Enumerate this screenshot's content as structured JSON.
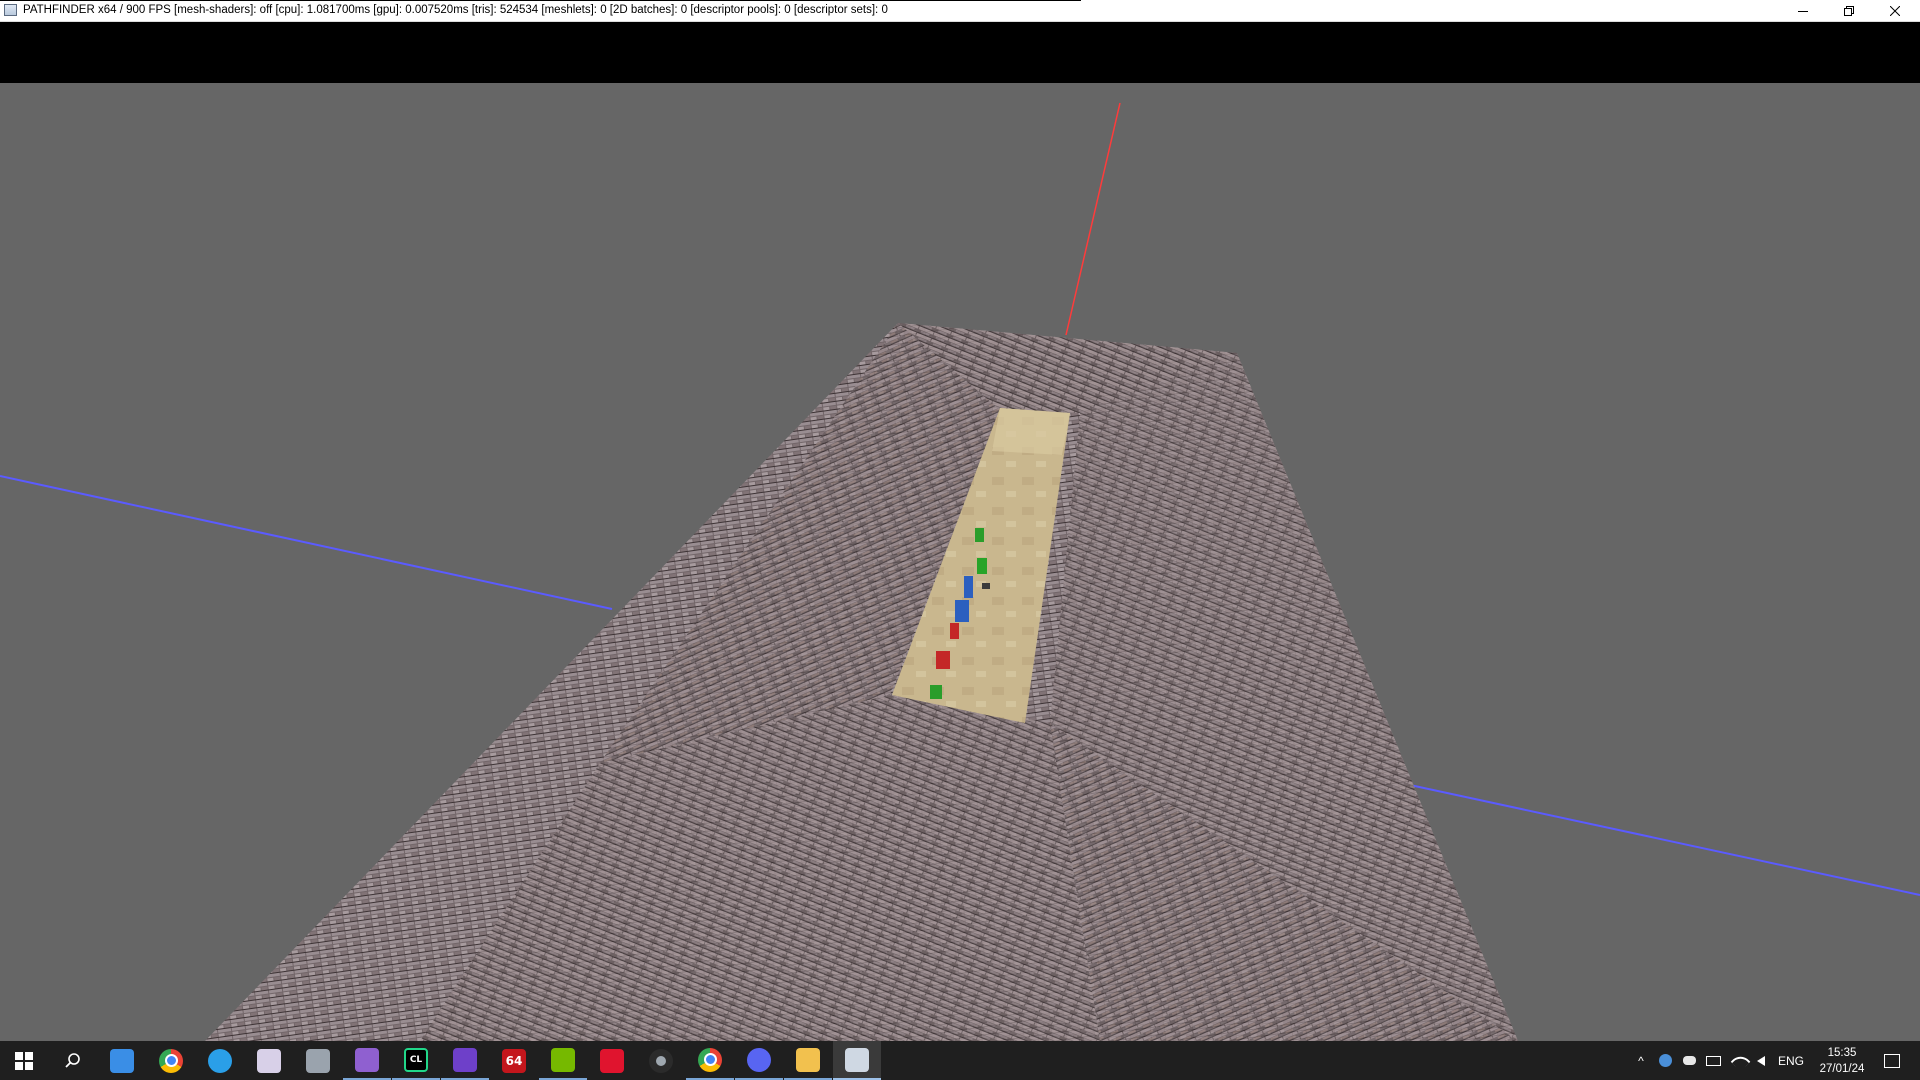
{
  "window": {
    "title": "PATHFINDER x64 / 900 FPS [mesh-shaders]: off [cpu]: 1.081700ms [gpu]: 0.007520ms  [tris]: 524534 [meshlets]: 0 [2D batches]: 0 [descriptor pools]: 0 [descriptor sets]: 0",
    "minimize_glyph": "—",
    "restore_glyph": "❐",
    "close_glyph": "✕"
  },
  "viewport": {
    "background": "#666666",
    "axis_x_color": "#5b5bff",
    "axis_y_color": "#ff3b3b",
    "surface_colors": [
      "#7a6c6e",
      "#9a8c90",
      "#b7aaaf",
      "#5a5052",
      "#a58f86"
    ],
    "trench_color": "#c8b58a"
  },
  "taskbar": {
    "apps": [
      {
        "name": "start-button",
        "icon": "windows-icon",
        "glyph": "",
        "color": "#ffffff"
      },
      {
        "name": "search-button",
        "icon": "search-icon",
        "glyph": "",
        "color": "#ffffff"
      },
      {
        "name": "app-laptop",
        "icon": "laptop-icon",
        "glyph": "",
        "color": "#3a8ee6"
      },
      {
        "name": "app-chrome",
        "icon": "chrome-icon",
        "glyph": "",
        "color": "#ea4335"
      },
      {
        "name": "app-compass",
        "icon": "compass-icon",
        "glyph": "",
        "color": "#2a9fe8"
      },
      {
        "name": "app-paint",
        "icon": "paint-icon",
        "glyph": "",
        "color": "#d8d0e8"
      },
      {
        "name": "app-utility",
        "icon": "toolbox-icon",
        "glyph": "",
        "color": "#9aa3ad"
      },
      {
        "name": "app-visual-studio",
        "icon": "visual-studio-icon",
        "glyph": "",
        "color": "#8f60d0"
      },
      {
        "name": "app-clion",
        "icon": "clion-icon",
        "glyph": "CL",
        "color": "#21d789"
      },
      {
        "name": "app-github",
        "icon": "github-icon",
        "glyph": "",
        "color": "#6e40c9"
      },
      {
        "name": "app-aida64",
        "icon": "aida64-icon",
        "glyph": "64",
        "color": "#c4161c"
      },
      {
        "name": "app-nvidia",
        "icon": "nvidia-icon",
        "glyph": "",
        "color": "#76b900"
      },
      {
        "name": "app-amd",
        "icon": "amd-icon",
        "glyph": "",
        "color": "#e0142e"
      },
      {
        "name": "app-obs",
        "icon": "obs-icon",
        "glyph": "",
        "color": "#2b2b2b"
      },
      {
        "name": "app-chrome-2",
        "icon": "chrome-icon",
        "glyph": "",
        "color": "#ea4335"
      },
      {
        "name": "app-discord",
        "icon": "discord-icon",
        "glyph": "",
        "color": "#5865f2"
      },
      {
        "name": "app-file-explorer",
        "icon": "folder-icon",
        "glyph": "",
        "color": "#f2c14e"
      },
      {
        "name": "app-pathfinder",
        "icon": "window-icon",
        "glyph": "",
        "color": "#cfd8e3"
      }
    ],
    "tray": {
      "chevron_glyph": "^",
      "language": "ENG",
      "time": "15:35",
      "date": "27/01/24"
    }
  }
}
